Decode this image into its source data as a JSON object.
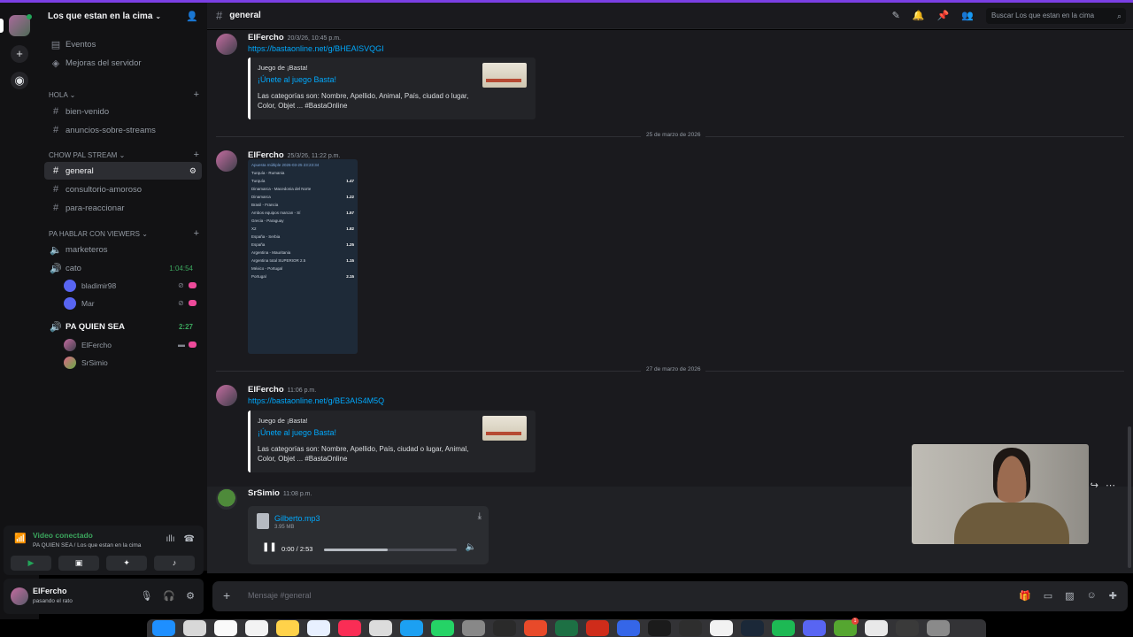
{
  "server": {
    "name": "Los que estan en la cima"
  },
  "sidebar": {
    "top_items": [
      {
        "label": "Eventos"
      },
      {
        "label": "Mejoras del servidor"
      }
    ],
    "categories": [
      {
        "name": "HOLA",
        "channels": [
          "bien-venido",
          "anuncios-sobre-streams"
        ]
      },
      {
        "name": "CHOW PAL STREAM",
        "channels": [
          "general",
          "consultorio-amoroso",
          "para-reaccionar"
        ]
      },
      {
        "name": "PA HABLAR CON VIEWERS",
        "channels": [
          "marketeros",
          "cato",
          "PA QUIEN SEA"
        ]
      }
    ],
    "cato_time": "1:04:54",
    "cato_users": [
      "bladimir98",
      "Mar"
    ],
    "paquiensea_time": "2:27",
    "paquiensea_users": [
      "ElFercho",
      "SrSimio"
    ]
  },
  "voice_panel": {
    "status": "Video conectado",
    "location": "PA QUIEN SEA / Los que estan en la cima"
  },
  "user_panel": {
    "name": "ElFercho",
    "status": "pasando el rato"
  },
  "header": {
    "channel": "general",
    "search_placeholder": "Buscar Los que estan en la cima"
  },
  "messages": [
    {
      "author": "ElFercho",
      "timestamp": "20/3/26, 10:45 p.m.",
      "link": "https://bastaonline.net/g/BHEAISVQGI",
      "embed": {
        "provider": "Juego de ¡Basta!",
        "title": "¡Únete al juego Basta!",
        "description": "Las categorías son: Nombre, Apellido, Animal, País, ciudad o lugar, Color, Objet ... #BastaOnline"
      }
    },
    {
      "divider": "25 de marzo de 2026"
    },
    {
      "author": "ElFercho",
      "timestamp": "25/3/26, 11:22 p.m.",
      "bets": {
        "header": "Apuesta múltiple 2026-03-25 23:23:34",
        "rows": [
          {
            "match": "Turquía - Rumania",
            "odd": ""
          },
          {
            "match": "Turquía",
            "odd": "1.47"
          },
          {
            "match": "Dinamarca - Macedonia del Norte",
            "odd": ""
          },
          {
            "match": "Dinamarca",
            "odd": "1.22"
          },
          {
            "match": "Brasil - Francia",
            "odd": ""
          },
          {
            "match": "Ambos equipos marcan - Sí",
            "odd": "1.57"
          },
          {
            "match": "Grecia - Paraguay",
            "odd": ""
          },
          {
            "match": "X2",
            "odd": "1.82"
          },
          {
            "match": "España - Serbia",
            "odd": ""
          },
          {
            "match": "España",
            "odd": "1.25"
          },
          {
            "match": "Argentina - Mauritania",
            "odd": ""
          },
          {
            "match": "Argentina total SUPERIOR 2.5",
            "odd": "1.15"
          },
          {
            "match": "México - Portugal",
            "odd": ""
          },
          {
            "match": "Portugal",
            "odd": "2.15"
          }
        ]
      }
    },
    {
      "divider": "27 de marzo de 2026"
    },
    {
      "author": "ElFercho",
      "timestamp": "11:06 p.m.",
      "link": "https://bastaonline.net/g/BE3AIS4M5Q",
      "embed": {
        "provider": "Juego de ¡Basta!",
        "title": "¡Únete al juego Basta!",
        "description": "Las categorías son: Nombre, Apellido, País, ciudad o lugar, Animal, Color, Objet ... #BastaOnline"
      }
    },
    {
      "author": "SrSimio",
      "timestamp": "11:08 p.m.",
      "attachment": {
        "filename": "Gilberto.mp3",
        "size": "3.95 MB",
        "time": "0:00 / 2:53",
        "progress_percent": 48
      }
    }
  ],
  "composer": {
    "placeholder": "Mensaje #general"
  },
  "colors": {
    "accent": "#7b3fe4",
    "link": "#00a8fc",
    "online": "#23a559"
  }
}
